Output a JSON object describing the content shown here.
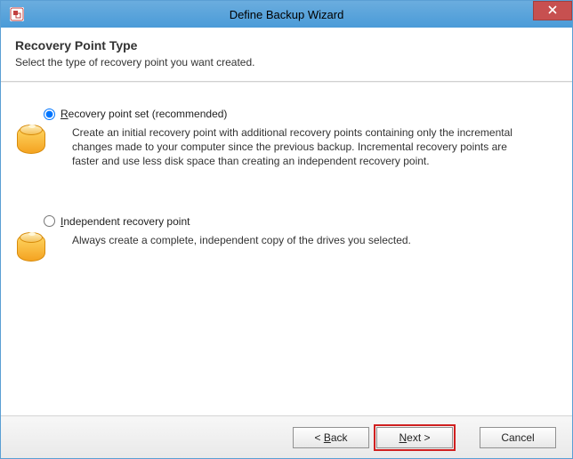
{
  "window": {
    "title": "Define Backup Wizard"
  },
  "header": {
    "title": "Recovery Point Type",
    "subtitle": "Select the type of recovery point you want created."
  },
  "options": {
    "recovery_set": {
      "label_pre": "R",
      "label_rest": "ecovery point set (recommended)",
      "description": "Create an initial recovery point with additional recovery points containing only the incremental changes made to your computer since the previous backup. Incremental recovery points are faster and use less disk space than creating an independent recovery point.",
      "checked": true
    },
    "independent": {
      "label_pre": "I",
      "label_rest": "ndependent recovery point",
      "description": "Always create a complete, independent copy of the drives you selected.",
      "checked": false
    }
  },
  "footer": {
    "back_pre": "< ",
    "back_m": "B",
    "back_post": "ack",
    "next_m": "N",
    "next_post": "ext >",
    "cancel": "Cancel"
  }
}
